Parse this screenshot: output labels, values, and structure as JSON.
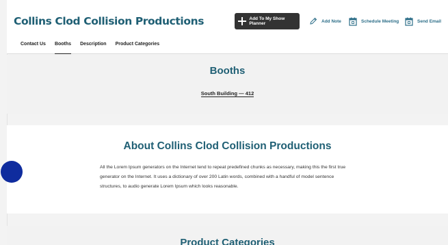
{
  "header": {
    "company_name": "Collins Clod Collision Productions",
    "planner_button": "Add To My Show Planner",
    "add_note": "Add Note",
    "schedule_meeting": "Schedule Meeting",
    "send_email": "Send Email"
  },
  "tabs": [
    {
      "label": "Contact Us",
      "active": false
    },
    {
      "label": "Booths",
      "active": true
    },
    {
      "label": "Description",
      "active": false
    },
    {
      "label": "Product Categories",
      "active": false
    }
  ],
  "booths": {
    "title": "Booths",
    "location": "South Building — 412"
  },
  "about": {
    "title": "About Collins Clod Collision Productions",
    "text": "All the Lorem Ipsum generators on the Internet tend to repeat predefined chunks as necessary, making this the first true generator on the Internet. It uses a dictionary of over 200 Latin words, combined with a handful of model sentence structures, to audio generate Lorem Ipsum which looks reasonable."
  },
  "categories": {
    "title": "Product Categories"
  },
  "colors": {
    "accent": "#1f5f74",
    "link": "#2d6e88",
    "dark_button": "#333333",
    "dot": "#0f2c9e"
  }
}
